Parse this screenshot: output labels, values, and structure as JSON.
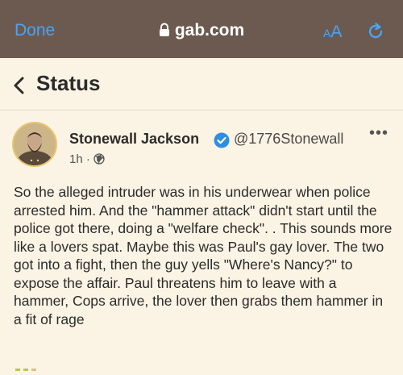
{
  "browser": {
    "done_label": "Done",
    "url": "gab.com",
    "text_size_small": "A",
    "text_size_large": "A",
    "accent_color": "#4aa3f5",
    "bar_color": "#6c5a50"
  },
  "header": {
    "title": "Status"
  },
  "post": {
    "author_name": "Stonewall Jackson",
    "handle": "@1776Stonewall",
    "age": "1h",
    "separator": "·",
    "visibility_icon": "globe-icon",
    "more_icon": "ellipsis-icon",
    "body": "So the alleged intruder was in his underwear when police arrested him. And the \"hammer attack\" didn't start until the police got there, doing a \"welfare check\". . This sounds more like a lovers spat. Maybe this was Paul's gay lover. The two got into a fight, then the guy yells \"Where's Nancy?\" to expose the affair. Paul threatens him to leave with a hammer, Cops arrive, the lover then grabs them hammer in a fit of rage"
  },
  "colors": {
    "page_background": "#fbf3e4",
    "verified_badge": "#2f8de4"
  }
}
